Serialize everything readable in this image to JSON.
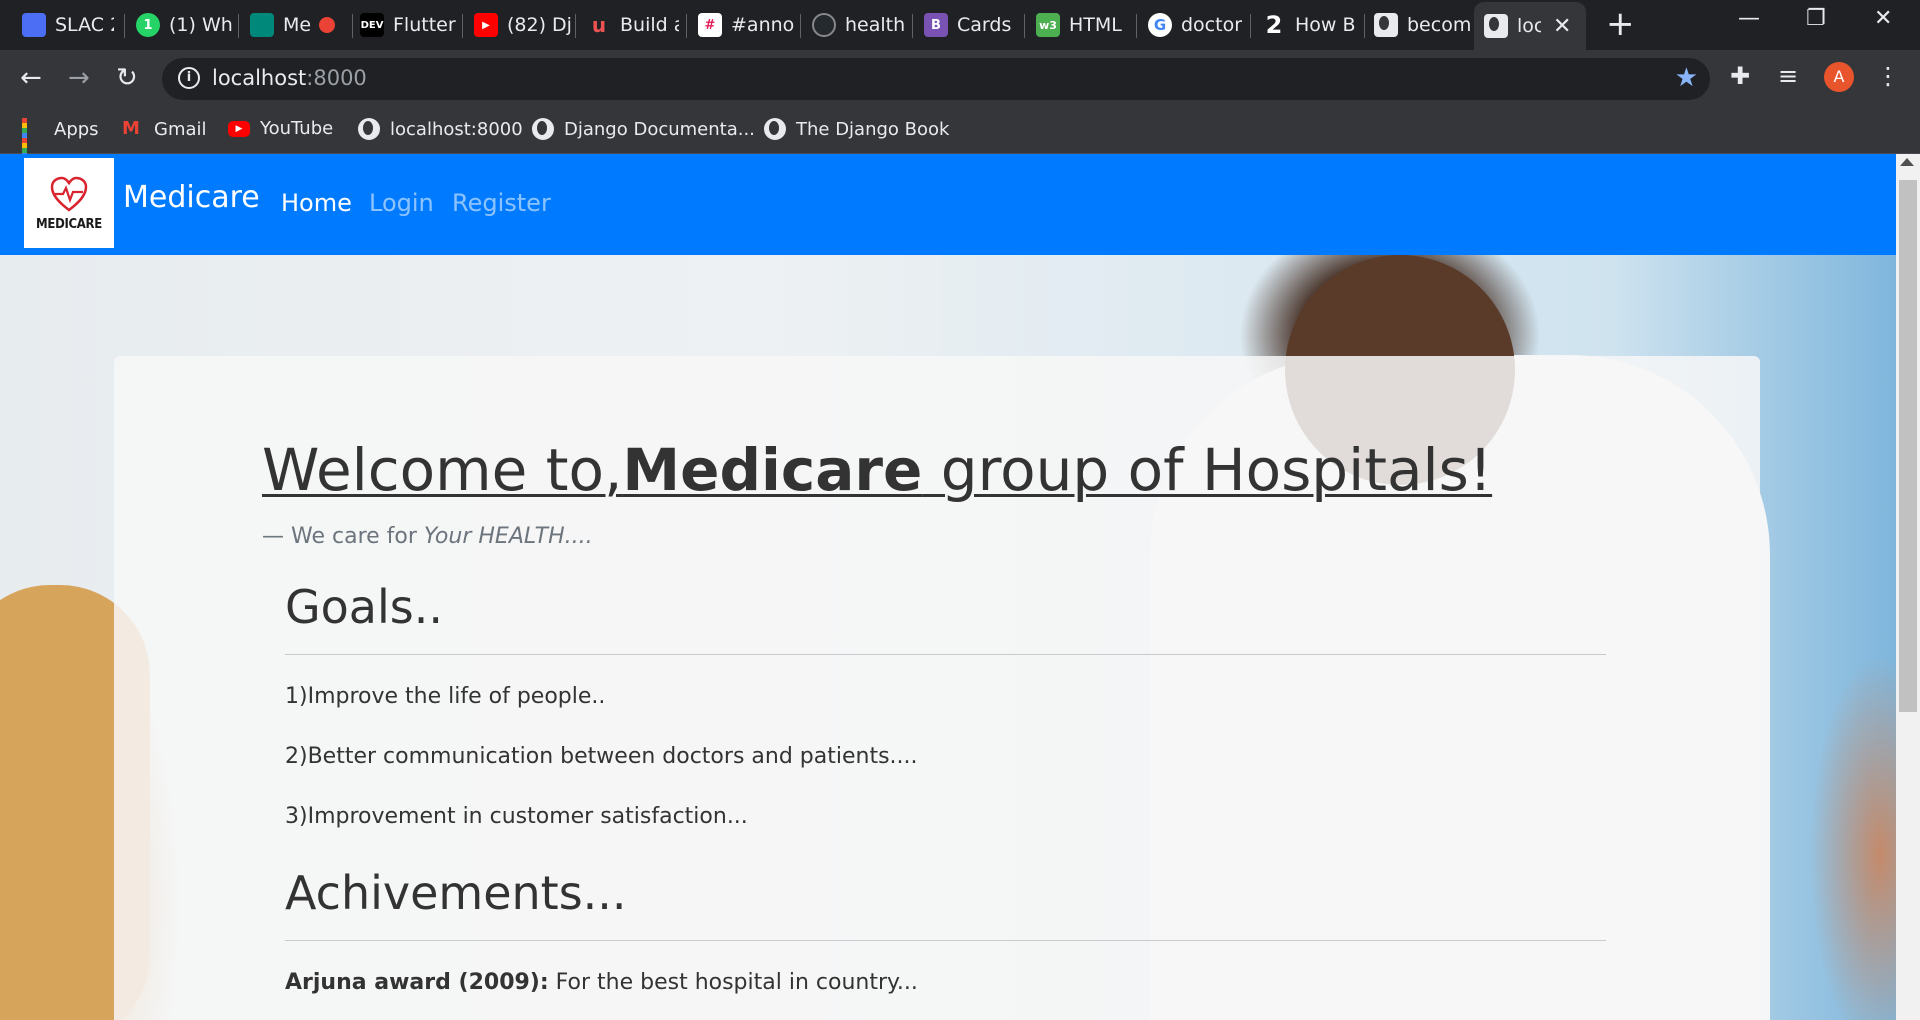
{
  "browser": {
    "tabs": [
      {
        "title": "SLAC 2",
        "icon": "doc-icon",
        "color": "#4c6ef5"
      },
      {
        "title": "(1) Wh",
        "icon": "whatsapp-icon",
        "color": "#25d366"
      },
      {
        "title": "Me",
        "icon": "meet-icon",
        "color": "#00897b"
      },
      {
        "title": "Flutter",
        "icon": "dev-icon",
        "color": "#000000"
      },
      {
        "title": "(82) Dj",
        "icon": "youtube-icon",
        "color": "#ff0000"
      },
      {
        "title": "Build a",
        "icon": "udemy-icon",
        "color": "#ec5252"
      },
      {
        "title": "#anno",
        "icon": "slack-icon",
        "color": "#e01e5a"
      },
      {
        "title": "health",
        "icon": "github-icon",
        "color": "#24292e"
      },
      {
        "title": "Cards",
        "icon": "bootstrap-icon",
        "color": "#7952b3"
      },
      {
        "title": "HTML",
        "icon": "w3schools-icon",
        "color": "#4caf50"
      },
      {
        "title": "doctor",
        "icon": "google-icon",
        "color": "#4285f4"
      },
      {
        "title": "How B",
        "icon": "quora-icon",
        "color": "#ffffff"
      },
      {
        "title": "becom",
        "icon": "globe-icon",
        "color": "#e8eaed"
      },
      {
        "title": "loc",
        "icon": "globe-icon",
        "color": "#e8eaed",
        "active": true
      }
    ],
    "url_host": "localhost",
    "url_port": ":8000",
    "avatar_letter": "A",
    "bookmarks": [
      "Apps",
      "Gmail",
      "YouTube",
      "localhost:8000",
      "Django Documenta...",
      "The Django Book"
    ]
  },
  "site": {
    "logo_text": "MEDICARE",
    "brand": "Medicare",
    "nav": [
      "Home",
      "Login",
      "Register"
    ],
    "welcome_prefix": "Welcome to,",
    "welcome_brand": "Medicare",
    "welcome_suffix": " group of Hospitals!",
    "tagline_prefix": "— We care for ",
    "tagline_em": "Your HEALTH....",
    "goals_heading": "Goals..",
    "goals": [
      "1)Improve the life of people..",
      "2)Better communication between doctors and patients....",
      "3)Improvement in customer satisfaction..."
    ],
    "achievements_heading": "Achivements...",
    "achievement_label": "Arjuna award (2009):",
    "achievement_text": " For the best hospital in country..."
  },
  "colors": {
    "navbar": "#007bff",
    "chrome_dark": "#202124",
    "chrome_mid": "#35363a"
  }
}
